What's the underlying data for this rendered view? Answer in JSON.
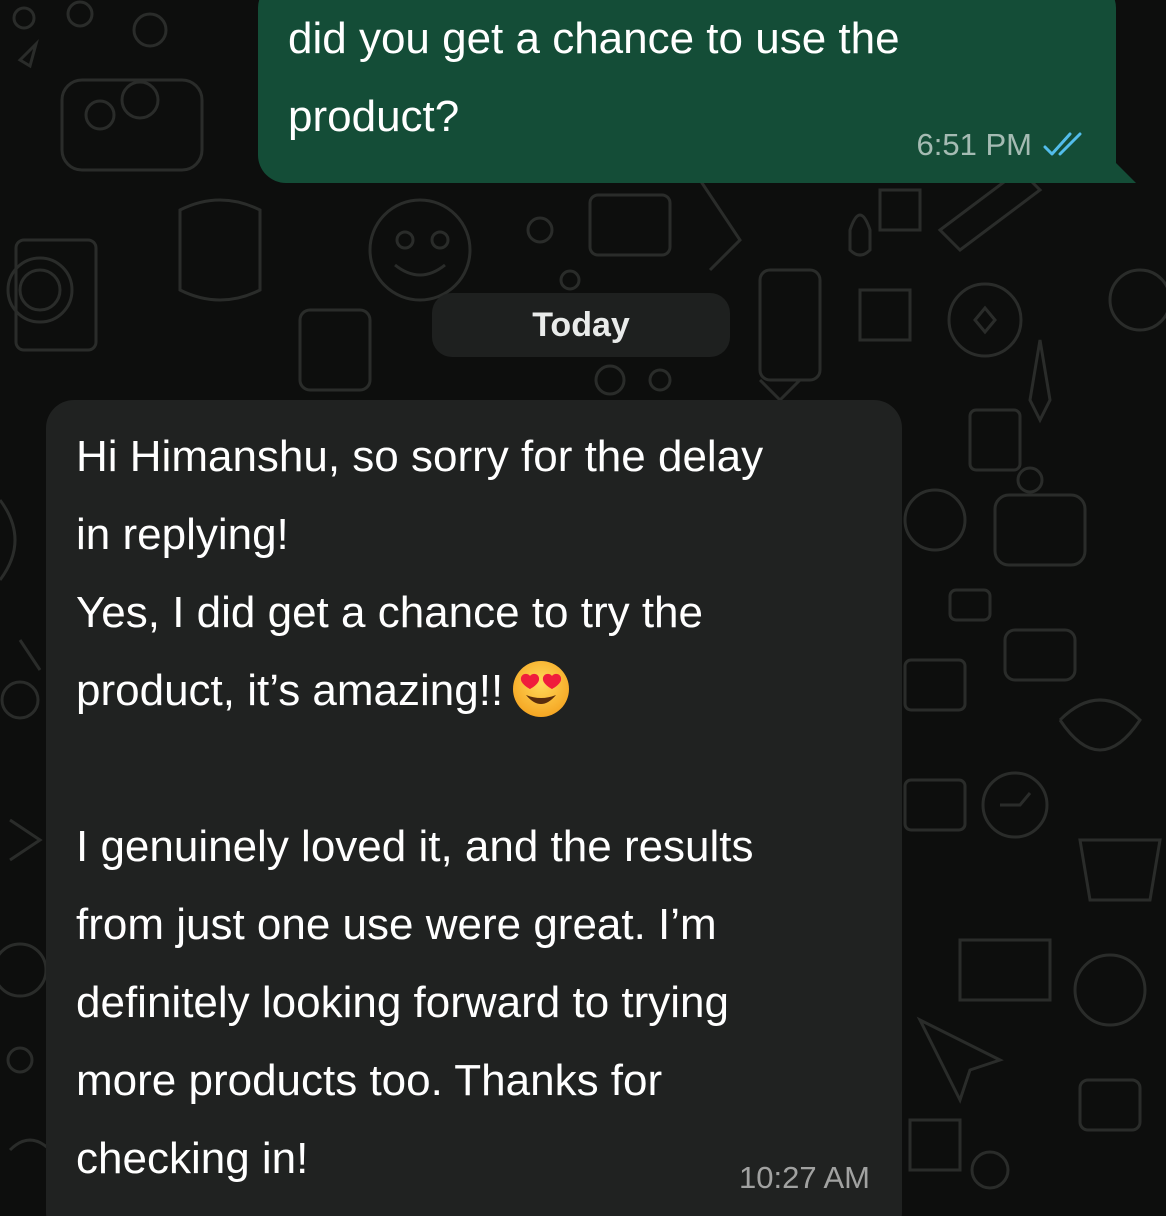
{
  "chat": {
    "date_divider": "Today",
    "messages": [
      {
        "direction": "outgoing",
        "text": "did you get a chance to use the\nproduct?",
        "time": "6:51 PM",
        "status_icon": "double-check-read-icon"
      },
      {
        "direction": "incoming",
        "text_before_emoji": "Hi Himanshu, so sorry for the delay\nin replying!\nYes, I did get a chance to try the\nproduct, it’s amazing!!",
        "emoji": "smiling-face-with-heart-eyes-icon",
        "text_after_emoji": "\n\nI genuinely loved it, and the results\nfrom just one use were great. I’m\ndefinitely looking forward to trying\nmore products too. Thanks for\nchecking in!",
        "time": "10:27 AM"
      }
    ]
  },
  "colors": {
    "background": "#0d0e0d",
    "outgoing_bubble": "#144d37",
    "incoming_bubble": "#202221",
    "read_ticks": "#53bdeb"
  }
}
